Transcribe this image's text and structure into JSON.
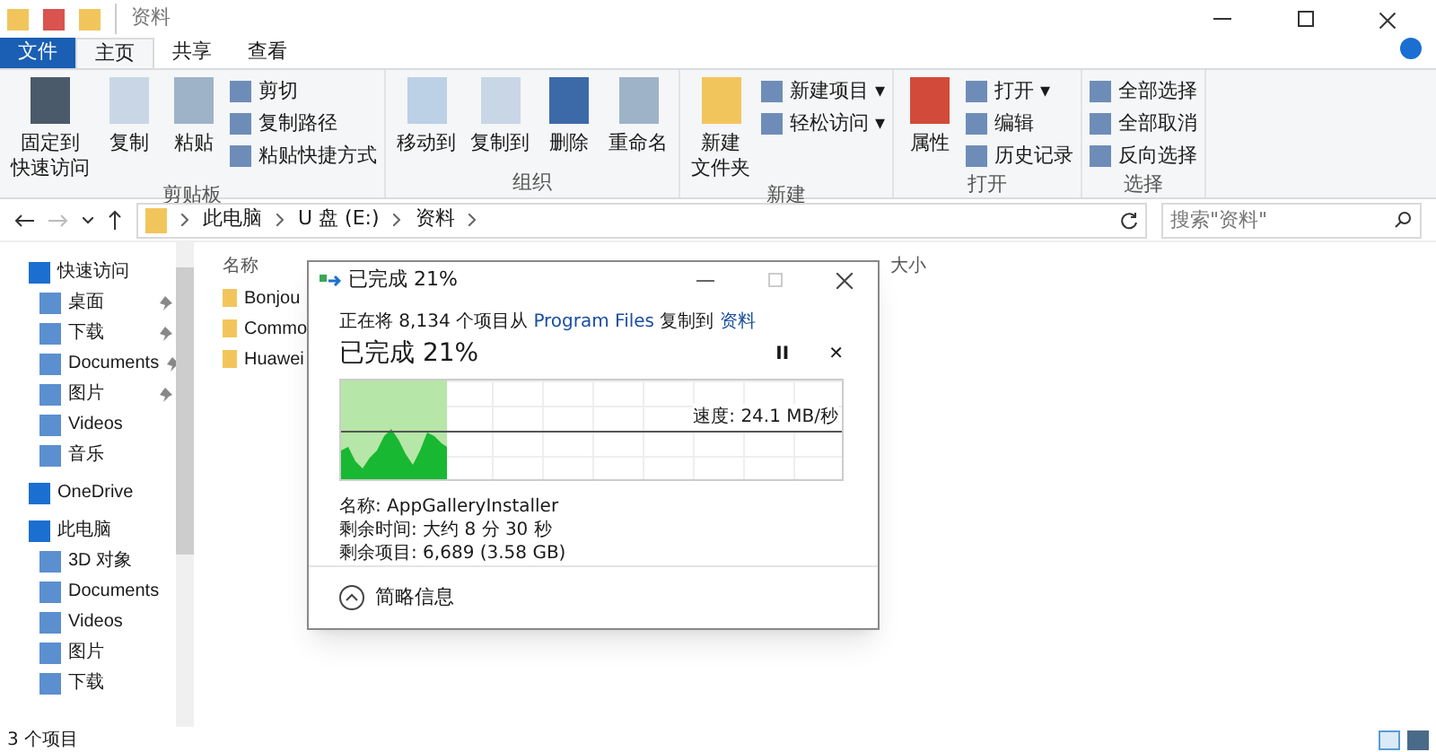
{
  "window": {
    "title": "资料"
  },
  "tabs": [
    {
      "label": "文件",
      "selected": false,
      "kind": "file"
    },
    {
      "label": "主页",
      "selected": true,
      "kind": "tab"
    },
    {
      "label": "共享",
      "selected": false,
      "kind": "tab"
    },
    {
      "label": "查看",
      "selected": false,
      "kind": "tab"
    }
  ],
  "ribbon": [
    {
      "title": "剪贴板",
      "big": [
        [
          "固定到",
          "快速访问"
        ],
        [
          "复制"
        ],
        [
          "粘贴"
        ]
      ],
      "small": [
        "剪切",
        "复制路径",
        "粘贴快捷方式"
      ]
    },
    {
      "title": "组织",
      "big": [
        [
          "移动到"
        ],
        [
          "复制到"
        ],
        [
          "删除"
        ],
        [
          "重命名"
        ]
      ]
    },
    {
      "title": "新建",
      "big": [
        [
          "新建",
          "文件夹"
        ]
      ],
      "small": [
        "新建项目 ▾",
        "轻松访问 ▾"
      ]
    },
    {
      "title": "打开",
      "big": [
        [
          "属性"
        ]
      ],
      "small": [
        "打开 ▾",
        "编辑",
        "历史记录"
      ]
    },
    {
      "title": "选择",
      "small": [
        "全部选择",
        "全部取消",
        "反向选择"
      ]
    }
  ],
  "address": {
    "path": [
      "此电脑",
      "U 盘 (E:)",
      "资料"
    ],
    "search_placeholder": "搜索\"资料\""
  },
  "sidebar": {
    "items": [
      {
        "label": "快速访问",
        "kind": "header",
        "pinned": false
      },
      {
        "label": "桌面",
        "kind": "item",
        "pinned": true
      },
      {
        "label": "下载",
        "kind": "item",
        "pinned": true
      },
      {
        "label": "Documents",
        "kind": "item",
        "pinned": true
      },
      {
        "label": "图片",
        "kind": "item",
        "pinned": true
      },
      {
        "label": "Videos",
        "kind": "item",
        "pinned": false
      },
      {
        "label": "音乐",
        "kind": "item",
        "pinned": false
      },
      {
        "label": "OneDrive",
        "kind": "header",
        "pinned": false
      },
      {
        "label": "此电脑",
        "kind": "header",
        "pinned": false
      },
      {
        "label": "3D 对象",
        "kind": "item",
        "pinned": false
      },
      {
        "label": "Documents",
        "kind": "item",
        "pinned": false
      },
      {
        "label": "Videos",
        "kind": "item",
        "pinned": false
      },
      {
        "label": "图片",
        "kind": "item",
        "pinned": false
      },
      {
        "label": "下载",
        "kind": "item",
        "pinned": false
      }
    ]
  },
  "file_list": {
    "columns": [
      "名称",
      "大小"
    ],
    "rows": [
      "Bonjou",
      "Commo",
      "Huawei"
    ]
  },
  "status_bar": {
    "count": "3 个项目"
  },
  "copy_dialog": {
    "title": "已完成 21%",
    "line_parts": [
      "正在将 8,134 个项目从",
      "Program Files",
      "复制到",
      "资料"
    ],
    "heading": "已完成 21%",
    "level": 0.21,
    "speed": "速度: 24.1 MB/秒",
    "pause": "II",
    "cancel": "✕",
    "details": [
      "名称: AppGalleryInstaller",
      "剩余时间: 大约 8 分 30 秒",
      "剩余项目: 6,689 (3.58 GB)"
    ],
    "toggle": "简略信息"
  }
}
